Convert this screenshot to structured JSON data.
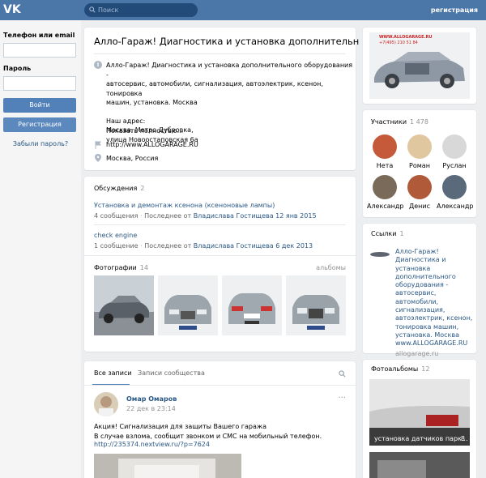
{
  "header": {
    "logo": "VK",
    "search_placeholder": "Поиск",
    "register_label": "регистрация"
  },
  "login": {
    "phone_label": "Телефон или email",
    "password_label": "Пароль",
    "login_button": "Войти",
    "register_button": "Регистрация",
    "forgot_link": "Забыли пароль?"
  },
  "group": {
    "title": "Алло-Гараж! Диагностика и установка дополнительн",
    "description_lines": [
      "Алло-Гараж! Диагностика и установка дополнительного оборудования -",
      "автосервис, автомобили, сигнализация, автоэлектрик, ксенон, тонировка",
      "машин, установка. Москва"
    ],
    "address_lines": [
      "Наш адрес:",
      "Москва, Метро Дубровка,",
      "улица Новоостаповская 6а"
    ],
    "show_more": "Показать полностью...",
    "website": "http://www.ALLOGARAGE.RU",
    "location": "Москва, Россия"
  },
  "discussions": {
    "header": "Обсуждения",
    "count": "2",
    "topics": [
      {
        "title": "Установка и демонтаж ксенона (ксеноновые лампы)",
        "messages": "4 сообщения",
        "last_prefix": "Последнее от",
        "last_author": "Владислава Гостищева",
        "last_date": "12 янв 2015"
      },
      {
        "title": "check engine",
        "messages": "1 сообщение",
        "last_prefix": "Последнее от",
        "last_author": "Владислава Гостищева",
        "last_date": "6 дек 2013"
      }
    ]
  },
  "photos": {
    "header": "Фотографии",
    "count": "14",
    "albums_link": "альбомы"
  },
  "wall": {
    "tab_all": "Все записи",
    "tab_community": "Записи сообщества",
    "post": {
      "author": "Омар Омаров",
      "date": "22 дек в 23:14",
      "text_lines": [
        "Акция! Сигнализация для защиты Вашего гаража",
        "В случае взлома, сообщит звонком и СМС на мобильный телефон."
      ],
      "link": "http://235374.nextview.ru/?p=7624",
      "more_dots": "···"
    }
  },
  "banner": {
    "site_text": "WWW.ALLOGARAGE.RU",
    "phone_text": "+7(495) 210 51 84"
  },
  "members": {
    "header": "Участники",
    "count": "1 478",
    "people": [
      {
        "name": "Нета",
        "color": "#c45a3a"
      },
      {
        "name": "Роман",
        "color": "#e0c7a0"
      },
      {
        "name": "Руслан",
        "color": "#d8d8d8"
      },
      {
        "name": "Александр",
        "color": "#7a6a5a"
      },
      {
        "name": "Денис",
        "color": "#b05a3a"
      },
      {
        "name": "Александр",
        "color": "#5a6a7a"
      }
    ]
  },
  "links": {
    "header": "Ссылки",
    "count": "1",
    "description_lines": [
      "Алло-Гараж!",
      "Диагностика и",
      "установка",
      "дополнительного",
      "оборудования -",
      "автосервис,",
      "автомобили,",
      "сигнализация,",
      "автоэлектрик, ксенон,",
      "тонировка машин,",
      "установка. Москва",
      "www.ALLOGARAGE.RU"
    ],
    "domain": "allogarage.ru"
  },
  "photo_albums": {
    "header": "Фотоальбомы",
    "count": "12",
    "album_title": "установка датчиков парк...",
    "album_count": "8"
  }
}
